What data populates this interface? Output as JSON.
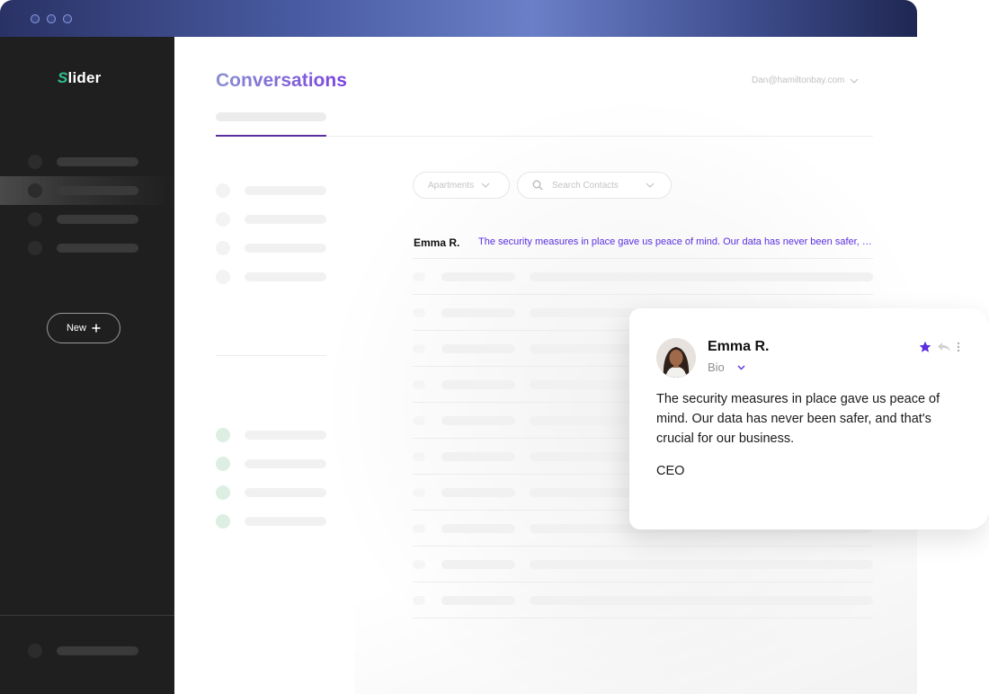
{
  "app": {
    "brand_first": "S",
    "brand_rest": "lider"
  },
  "sidebar": {
    "new_button": "New"
  },
  "header": {
    "title": "Conversations",
    "account_email": "Dan@hamiltonbay.com"
  },
  "filters": {
    "category": "Apartments",
    "search_placeholder": "Search Contacts"
  },
  "conversations": [
    {
      "name": "Emma R.",
      "message": "The security measures in place gave us peace of mind. Our data has never been safer, and that's crucial for our business."
    }
  ],
  "detail_card": {
    "name": "Emma R.",
    "bio_label": "Bio",
    "message": "The security measures in place gave us peace of mind. Our data has never been safer, and that's crucial for our business.",
    "role": "CEO",
    "accent_color": "#5b2ee0"
  },
  "colors": {
    "sidebar": "#1f1f1f",
    "accent": "#5b2ee0",
    "brand_green": "#2fbf8f"
  }
}
